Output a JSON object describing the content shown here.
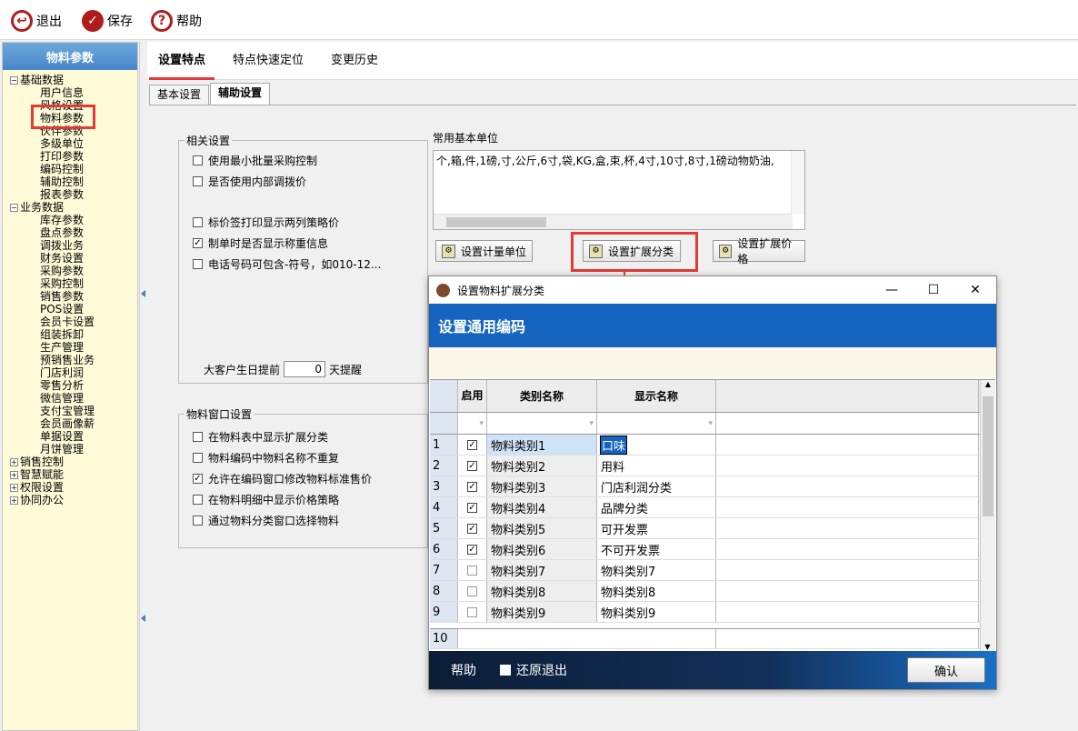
{
  "toolbar": {
    "exit_label": "退出",
    "save_label": "保存",
    "help_label": "帮助"
  },
  "sidebar": {
    "title": "物料参数",
    "groups": [
      {
        "label": "基础数据",
        "expanded": true,
        "items": [
          "用户信息",
          "风格设置",
          "物料参数",
          "伙伴参数",
          "多级单位",
          "打印参数",
          "编码控制",
          "辅助控制",
          "报表参数"
        ]
      },
      {
        "label": "业务数据",
        "expanded": true,
        "items": [
          "库存参数",
          "盘点参数",
          "调拨业务",
          "财务设置",
          "采购参数",
          "采购控制",
          "销售参数",
          "POS设置",
          "会员卡设置",
          "组装拆卸",
          "生产管理",
          "预销售业务",
          "门店利润",
          "零售分析",
          "微信管理",
          "支付宝管理",
          "会员画像薪",
          "单据设置",
          "月饼管理"
        ]
      },
      {
        "label": "销售控制",
        "expanded": false,
        "items": []
      },
      {
        "label": "智慧赋能",
        "expanded": false,
        "items": []
      },
      {
        "label": "权限设置",
        "expanded": false,
        "items": []
      },
      {
        "label": "协同办公",
        "expanded": false,
        "items": []
      }
    ]
  },
  "main": {
    "tabs": [
      "设置特点",
      "特点快速定位",
      "变更历史"
    ],
    "subtabs": [
      "基本设置",
      "辅助设置"
    ],
    "related": {
      "legend": "相关设置",
      "options": [
        {
          "label": "使用最小批量采购控制",
          "checked": false
        },
        {
          "label": "是否使用内部调拨价",
          "checked": false
        },
        {
          "label": "标价签打印显示两列策略价",
          "checked": false
        },
        {
          "label": "制单时是否显示称重信息",
          "checked": true
        },
        {
          "label": "电话号码可包含-符号，如010-12...",
          "checked": false
        }
      ],
      "birthday_prefix": "大客户生日提前",
      "birthday_value": "0",
      "birthday_suffix": "天提醒"
    },
    "window_settings": {
      "legend": "物料窗口设置",
      "options": [
        {
          "label": "在物料表中显示扩展分类",
          "checked": false
        },
        {
          "label": "物料编码中物料名称不重复",
          "checked": false
        },
        {
          "label": "允许在编码窗口修改物料标准售价",
          "checked": true
        },
        {
          "label": "在物料明细中显示价格策略",
          "checked": false
        },
        {
          "label": "通过物料分类窗口选择物料",
          "checked": false
        }
      ]
    },
    "units": {
      "label": "常用基本单位",
      "value": "个,箱,件,1磅,寸,公斤,6寸,袋,KG,盒,束,杯,4寸,10寸,8寸,1磅动物奶油,",
      "btn_unit": "设置计量单位",
      "btn_category": "设置扩展分类",
      "btn_price": "设置扩展价格"
    }
  },
  "dialog": {
    "title": "设置物料扩展分类",
    "header": "设置通用编码",
    "columns": {
      "enable": "启用",
      "category": "类别名称",
      "display": "显示名称"
    },
    "rows": [
      {
        "no": "1",
        "enabled": true,
        "category": "物料类别1",
        "display": "口味"
      },
      {
        "no": "2",
        "enabled": true,
        "category": "物料类别2",
        "display": "用料"
      },
      {
        "no": "3",
        "enabled": true,
        "category": "物料类别3",
        "display": "门店利润分类"
      },
      {
        "no": "4",
        "enabled": true,
        "category": "物料类别4",
        "display": "品牌分类"
      },
      {
        "no": "5",
        "enabled": true,
        "category": "物料类别5",
        "display": "可开发票"
      },
      {
        "no": "6",
        "enabled": true,
        "category": "物料类别6",
        "display": "不可开发票"
      },
      {
        "no": "7",
        "enabled": false,
        "category": "物料类别7",
        "display": "物料类别7"
      },
      {
        "no": "8",
        "enabled": false,
        "category": "物料类别8",
        "display": "物料类别8"
      },
      {
        "no": "9",
        "enabled": false,
        "category": "物料类别9",
        "display": "物料类别9"
      }
    ],
    "new_row_no": "10",
    "footer": {
      "help": "帮助",
      "restore_exit": "还原退出",
      "confirm": "确认"
    }
  }
}
